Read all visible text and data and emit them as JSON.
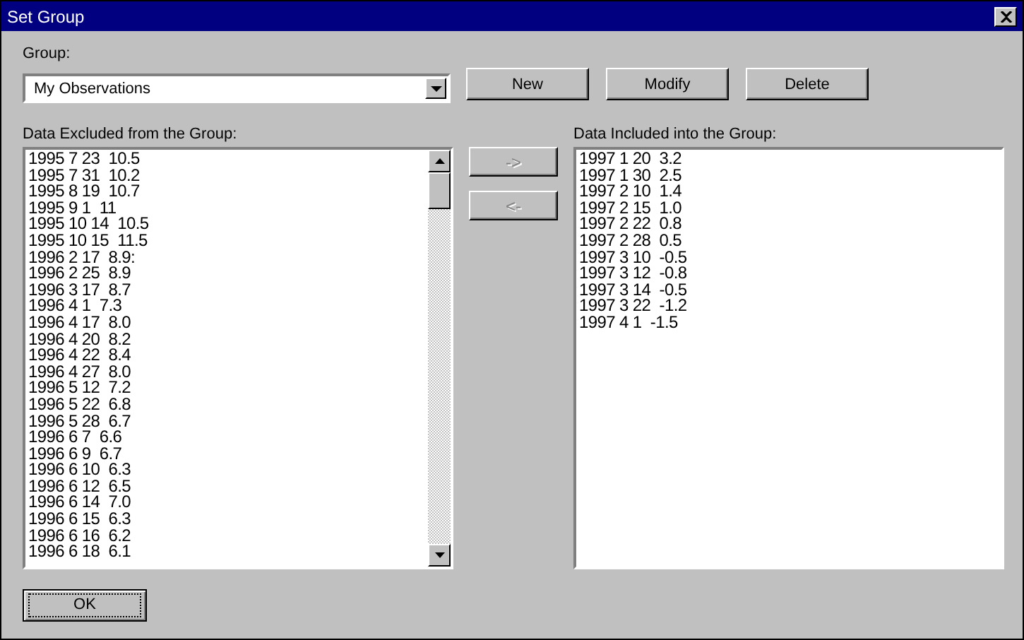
{
  "window": {
    "title": "Set Group"
  },
  "group": {
    "label": "Group:",
    "value": "My Observations"
  },
  "buttons": [
    {
      "label": "New"
    },
    {
      "label": "Modify"
    },
    {
      "label": "Delete"
    }
  ],
  "excluded": {
    "label": "Data Excluded from the Group:",
    "items": [
      "1995 7 23  10.5",
      "1995 7 31  10.2",
      "1995 8 19  10.7",
      "1995 9 1  11",
      "1995 10 14  10.5",
      "1995 10 15  11.5",
      "1996 2 17  8.9:",
      "1996 2 25  8.9",
      "1996 3 17  8.7",
      "1996 4 1  7.3",
      "1996 4 17  8.0",
      "1996 4 20  8.2",
      "1996 4 22  8.4",
      "1996 4 27  8.0",
      "1996 5 12  7.2",
      "1996 5 22  6.8",
      "1996 5 28  6.7",
      "1996 6 7  6.6",
      "1996 6 9  6.7",
      "1996 6 10  6.3",
      "1996 6 12  6.5",
      "1996 6 14  7.0",
      "1996 6 15  6.3",
      "1996 6 16  6.2",
      "1996 6 18  6.1"
    ]
  },
  "move_buttons": [
    {
      "label": "->",
      "disabled": true
    },
    {
      "label": "<-",
      "disabled": true
    }
  ],
  "included": {
    "label": "Data Included into the Group:",
    "items": [
      "1997 1 20  3.2",
      "1997 1 30  2.5",
      "1997 2 10  1.4",
      "1997 2 15  1.0",
      "1997 2 22  0.8",
      "1997 2 28  0.5",
      "1997 3 10  -0.5",
      "1997 3 12  -0.8",
      "1997 3 14  -0.5",
      "1997 3 22  -1.2",
      "1997 4 1  -1.5"
    ]
  },
  "ok_button": {
    "label": "OK"
  }
}
